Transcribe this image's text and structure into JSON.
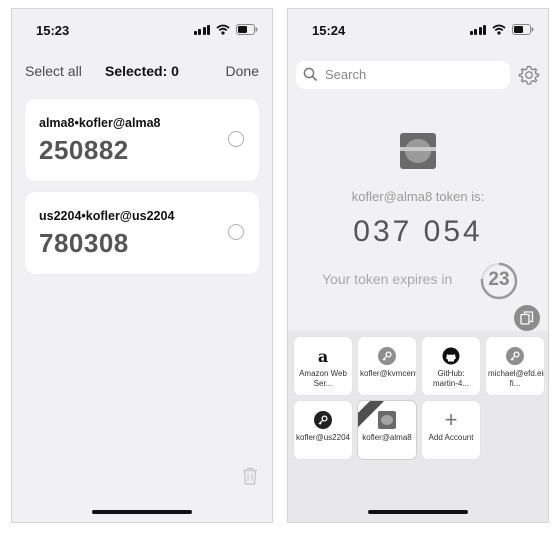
{
  "left_screen": {
    "status_time": "15:23",
    "toolbar": {
      "select_all": "Select all",
      "selected_count": "Selected: 0",
      "done": "Done"
    },
    "tokens": [
      {
        "account": "alma8•kofler@alma8",
        "code": "250882",
        "selected": false
      },
      {
        "account": "us2204•kofler@us2204",
        "code": "780308",
        "selected": false
      }
    ],
    "trash_icon": "trash-icon"
  },
  "right_screen": {
    "status_time": "15:24",
    "search": {
      "placeholder": "Search"
    },
    "settings_icon": "gear-icon",
    "token_label": "kofler@alma8 token is:",
    "token_code": "037 054",
    "expires_text": "Your token expires in",
    "countdown": "23",
    "countdown_fraction_remaining": 0.77,
    "accounts": [
      {
        "label": "Amazon Web Ser...",
        "icon": "amazon-icon"
      },
      {
        "label": "kofler@kvmcentos",
        "icon": "key-icon"
      },
      {
        "label": "GitHub: martin-4...",
        "icon": "github-icon"
      },
      {
        "label": "michael@efd.eine-fi...",
        "icon": "key-icon"
      },
      {
        "label": "kofler@us2204",
        "icon": "key-icon"
      },
      {
        "label": "kofler@alma8",
        "icon": "avatar-icon",
        "selected": true
      },
      {
        "label": "Add Account",
        "icon": "plus-icon"
      }
    ]
  },
  "colors": {
    "screen_background": "#f1f1f3",
    "card_background": "#ffffff",
    "panel_background": "#e8e8ea",
    "code_text": "#555555",
    "muted_text": "#9a9a9a"
  }
}
